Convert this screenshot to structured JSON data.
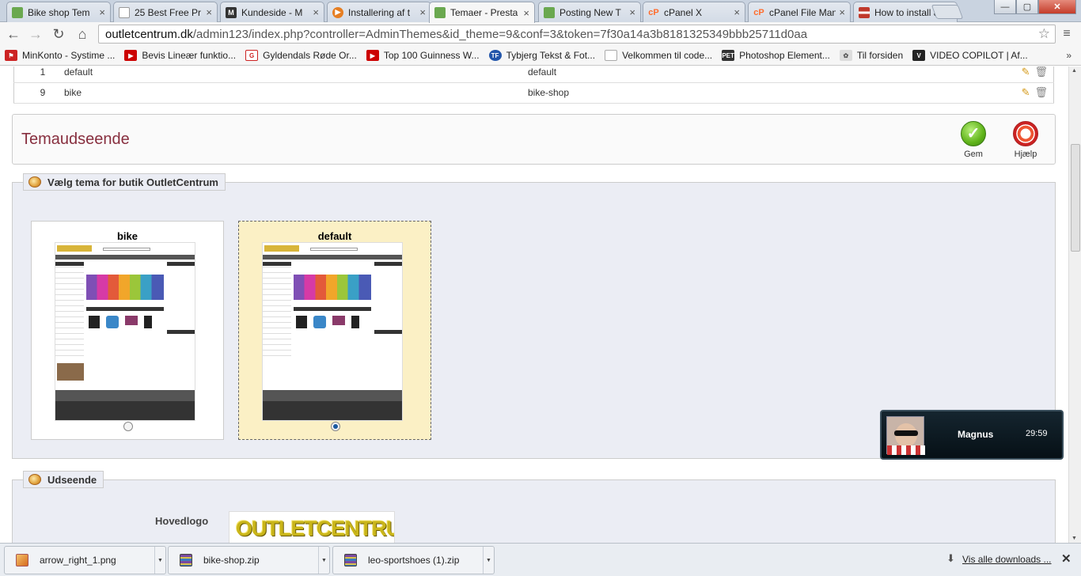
{
  "tabs": [
    {
      "title": "Bike shop Tem",
      "icon": "prestashop-icon",
      "color": "#6aa84f"
    },
    {
      "title": "25 Best Free Pr",
      "icon": "page-icon",
      "color": "#999999"
    },
    {
      "title": "Kundeside - M",
      "icon": "m-icon",
      "color": "#333333"
    },
    {
      "title": "Installering af t",
      "icon": "play-icon",
      "color": "#e67e22"
    },
    {
      "title": "Temaer - Presta",
      "icon": "prestashop-icon",
      "color": "#6aa84f"
    },
    {
      "title": "Posting New T",
      "icon": "prestashop-icon",
      "color": "#6aa84f"
    },
    {
      "title": "cPanel X",
      "icon": "cpanel-icon",
      "color": "#ff6c2c"
    },
    {
      "title": "cPanel File Man",
      "icon": "cpanel-icon",
      "color": "#ff6c2c"
    },
    {
      "title": "How to install a",
      "icon": "flag-icon",
      "color": "#c0392b"
    }
  ],
  "url": {
    "host": "outletcentrum.dk",
    "path": "/admin123/index.php?controller=AdminThemes&id_theme=9&conf=3&token=7f30a14a3b8181325349bbb25711d0aa"
  },
  "bookmarks": [
    {
      "label": "MinKonto - Systime ...",
      "color": "#cc2222"
    },
    {
      "label": "Bevis Lineær funktio...",
      "color": "#cc0000"
    },
    {
      "label": "Gyldendals Røde Or...",
      "color": "#cc2222"
    },
    {
      "label": "Top 100 Guinness W...",
      "color": "#cc0000"
    },
    {
      "label": "Tybjerg Tekst & Fot...",
      "color": "#2255aa"
    },
    {
      "label": "Velkommen til code...",
      "color": "#bbbbbb"
    },
    {
      "label": "Photoshop Element...",
      "color": "#333333"
    },
    {
      "label": "Til forsiden",
      "color": "#888888"
    },
    {
      "label": "VIDEO COPILOT | Af...",
      "color": "#222222"
    }
  ],
  "theme_table": [
    {
      "id": "1",
      "name": "default",
      "directory": "default"
    },
    {
      "id": "9",
      "name": "bike",
      "directory": "bike-shop"
    }
  ],
  "panel": {
    "title": "Temaudseende",
    "save_label": "Gem",
    "help_label": "Hjælp"
  },
  "select_theme": {
    "legend": "Vælg tema for butik OutletCentrum",
    "themes": [
      {
        "name": "bike",
        "selected": false
      },
      {
        "name": "default",
        "selected": true
      }
    ]
  },
  "appearance": {
    "legend": "Udseende",
    "main_logo_label": "Hovedlogo",
    "logo_text": "OUTLETCENTRUM"
  },
  "video_call": {
    "name": "Magnus",
    "time": "29:59"
  },
  "downloads": [
    {
      "file": "arrow_right_1.png"
    },
    {
      "file": "bike-shop.zip"
    },
    {
      "file": "leo-sportshoes (1).zip"
    }
  ],
  "downloads_link": "Vis alle downloads ..."
}
